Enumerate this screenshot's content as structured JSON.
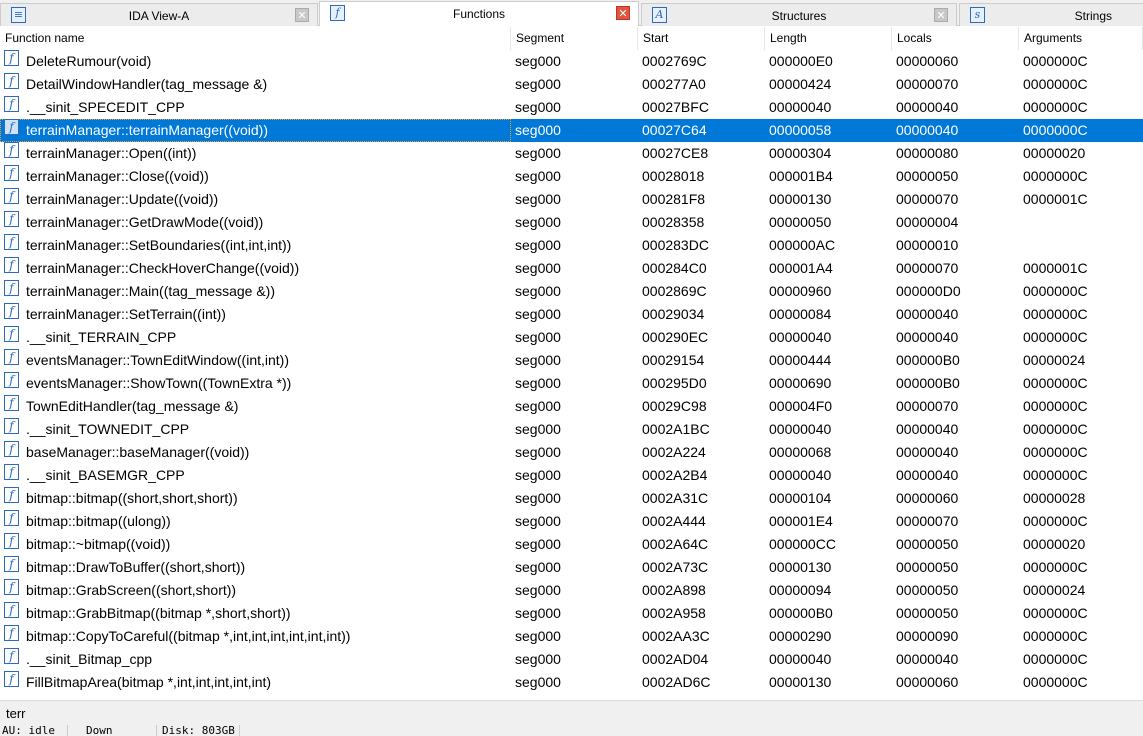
{
  "tabs": [
    {
      "label": "IDA View-A",
      "icon": "disassembly-icon",
      "active": false
    },
    {
      "label": "Functions",
      "icon": "function-icon",
      "active": true
    },
    {
      "label": "Structures",
      "icon": "structure-icon",
      "active": false
    },
    {
      "label": "Strings",
      "icon": "strings-icon",
      "active": false
    }
  ],
  "columns": [
    "Function name",
    "Segment",
    "Start",
    "Length",
    "Locals",
    "Arguments"
  ],
  "rows": [
    [
      "DeleteRumour(void)",
      "seg000",
      "0002769C",
      "000000E0",
      "00000060",
      "0000000C"
    ],
    [
      "DetailWindowHandler(tag_message &)",
      "seg000",
      "000277A0",
      "00000424",
      "00000070",
      "0000000C"
    ],
    [
      ".__sinit_SPECEDIT_CPP",
      "seg000",
      "00027BFC",
      "00000040",
      "00000040",
      "0000000C"
    ],
    [
      "terrainManager::terrainManager((void))",
      "seg000",
      "00027C64",
      "00000058",
      "00000040",
      "0000000C"
    ],
    [
      "terrainManager::Open((int))",
      "seg000",
      "00027CE8",
      "00000304",
      "00000080",
      "00000020"
    ],
    [
      "terrainManager::Close((void))",
      "seg000",
      "00028018",
      "000001B4",
      "00000050",
      "0000000C"
    ],
    [
      "terrainManager::Update((void))",
      "seg000",
      "000281F8",
      "00000130",
      "00000070",
      "0000001C"
    ],
    [
      "terrainManager::GetDrawMode((void))",
      "seg000",
      "00028358",
      "00000050",
      "00000004",
      ""
    ],
    [
      "terrainManager::SetBoundaries((int,int,int))",
      "seg000",
      "000283DC",
      "000000AC",
      "00000010",
      ""
    ],
    [
      "terrainManager::CheckHoverChange((void))",
      "seg000",
      "000284C0",
      "000001A4",
      "00000070",
      "0000001C"
    ],
    [
      "terrainManager::Main((tag_message &))",
      "seg000",
      "0002869C",
      "00000960",
      "000000D0",
      "0000000C"
    ],
    [
      "terrainManager::SetTerrain((int))",
      "seg000",
      "00029034",
      "00000084",
      "00000040",
      "0000000C"
    ],
    [
      ".__sinit_TERRAIN_CPP",
      "seg000",
      "000290EC",
      "00000040",
      "00000040",
      "0000000C"
    ],
    [
      "eventsManager::TownEditWindow((int,int))",
      "seg000",
      "00029154",
      "00000444",
      "000000B0",
      "00000024"
    ],
    [
      "eventsManager::ShowTown((TownExtra *))",
      "seg000",
      "000295D0",
      "00000690",
      "000000B0",
      "0000000C"
    ],
    [
      "TownEditHandler(tag_message &)",
      "seg000",
      "00029C98",
      "000004F0",
      "00000070",
      "0000000C"
    ],
    [
      ".__sinit_TOWNEDIT_CPP",
      "seg000",
      "0002A1BC",
      "00000040",
      "00000040",
      "0000000C"
    ],
    [
      "baseManager::baseManager((void))",
      "seg000",
      "0002A224",
      "00000068",
      "00000040",
      "0000000C"
    ],
    [
      ".__sinit_BASEMGR_CPP",
      "seg000",
      "0002A2B4",
      "00000040",
      "00000040",
      "0000000C"
    ],
    [
      "bitmap::bitmap((short,short,short))",
      "seg000",
      "0002A31C",
      "00000104",
      "00000060",
      "00000028"
    ],
    [
      "bitmap::bitmap((ulong))",
      "seg000",
      "0002A444",
      "000001E4",
      "00000070",
      "0000000C"
    ],
    [
      "bitmap::~bitmap((void))",
      "seg000",
      "0002A64C",
      "000000CC",
      "00000050",
      "00000020"
    ],
    [
      "bitmap::DrawToBuffer((short,short))",
      "seg000",
      "0002A73C",
      "00000130",
      "00000050",
      "0000000C"
    ],
    [
      "bitmap::GrabScreen((short,short))",
      "seg000",
      "0002A898",
      "00000094",
      "00000050",
      "00000024"
    ],
    [
      "bitmap::GrabBitmap((bitmap *,short,short))",
      "seg000",
      "0002A958",
      "000000B0",
      "00000050",
      "0000000C"
    ],
    [
      "bitmap::CopyToCareful((bitmap *,int,int,int,int,int,int))",
      "seg000",
      "0002AA3C",
      "00000290",
      "00000090",
      "0000000C"
    ],
    [
      ".__sinit_Bitmap_cpp",
      "seg000",
      "0002AD04",
      "00000040",
      "00000040",
      "0000000C"
    ],
    [
      "FillBitmapArea(bitmap *,int,int,int,int,int)",
      "seg000",
      "0002AD6C",
      "00000130",
      "00000060",
      "0000000C"
    ]
  ],
  "selected_row": 3,
  "filter": "terr",
  "status": {
    "autoanalysis": "AU:  idle",
    "direction": "Down",
    "disk": "Disk: 803GB"
  },
  "colors": {
    "selection": "#0078d7",
    "icon": "#2a6bbf"
  }
}
